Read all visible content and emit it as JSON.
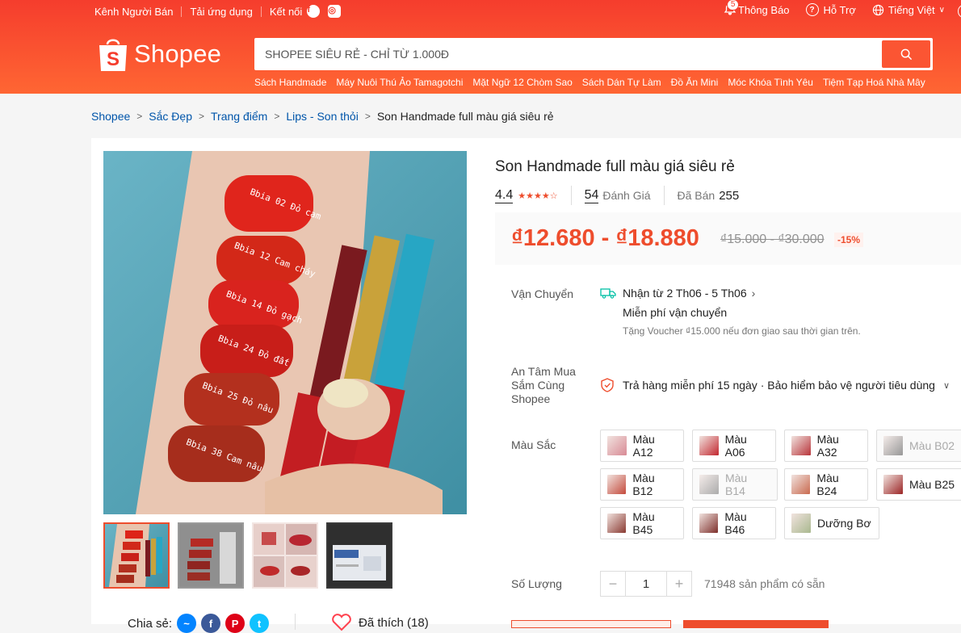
{
  "topbar": {
    "seller_center": "Kênh Người Bán",
    "download_app": "Tải ứng dụng",
    "connect": "Kết nối",
    "notifications": "Thông Báo",
    "notification_count": "5",
    "help": "Hỗ Trợ",
    "language": "Tiếng Việt"
  },
  "logo": {
    "text": "Shopee"
  },
  "search": {
    "placeholder": "SHOPEE SIÊU RẺ - CHỈ TỪ 1.000Đ",
    "suggestions": [
      "Sách Handmade",
      "Máy Nuôi Thú Ảo Tamagotchi",
      "Mặt Ngữ 12 Chòm Sao",
      "Sách Dán Tự Làm",
      "Đồ Ăn Mini",
      "Móc Khóa Tình Yêu",
      "Tiệm Tạp Hoá Nhà Mây"
    ]
  },
  "breadcrumb": {
    "items": [
      "Shopee",
      "Sắc Đẹp",
      "Trang điểm",
      "Lips - Son thỏi"
    ],
    "current": "Son Handmade full màu giá siêu rẻ"
  },
  "gallery": {
    "swatch_labels": [
      "Bbia 02 Đỏ cam",
      "Bbia 12 Cam cháy",
      "Bbia 14 Đỏ gạch",
      "Bbia 24 Đỏ đất",
      "Bbia 25 Đỏ nâu",
      "Bbia 38 Cam nâu"
    ]
  },
  "share": {
    "label": "Chia sẻ:"
  },
  "like": {
    "label": "Đã thích (18)"
  },
  "product": {
    "title": "Son Handmade full màu giá siêu rẻ",
    "rating": "4.4",
    "rating_stars": 4.4,
    "reviews_count": "54",
    "reviews_label": "Đánh Giá",
    "sold_label": "Đã Bán",
    "sold_count": "255",
    "price": "₫12.680 - ₫18.880",
    "original_price": "₫15.000 - ₫30.000",
    "discount": "-15%"
  },
  "shipping": {
    "label": "Vận Chuyển",
    "eta": "Nhận từ 2 Th06 - 5 Th06",
    "free": "Miễn phí vận chuyển",
    "voucher": "Tặng Voucher ₫15.000 nếu đơn giao sau thời gian trên."
  },
  "guarantee": {
    "label": "An Tâm Mua Sắm Cùng Shopee",
    "text": "Trả hàng miễn phí 15 ngày · Bảo hiểm bảo vệ người tiêu dùng"
  },
  "colors": {
    "label": "Màu Sắc",
    "options": [
      {
        "label": "Màu A12",
        "disabled": false,
        "swatch": "#d88a95"
      },
      {
        "label": "Màu A06",
        "disabled": false,
        "swatch": "#c2272f"
      },
      {
        "label": "Màu A32",
        "disabled": false,
        "swatch": "#b8343a"
      },
      {
        "label": "Màu B02",
        "disabled": true,
        "swatch": "#555555"
      },
      {
        "label": "Màu B12",
        "disabled": false,
        "swatch": "#c44a3c"
      },
      {
        "label": "Màu B14",
        "disabled": true,
        "swatch": "#777777"
      },
      {
        "label": "Màu B24",
        "disabled": false,
        "swatch": "#c96a4f"
      },
      {
        "label": "Màu B25",
        "disabled": false,
        "swatch": "#9b2525"
      },
      {
        "label": "Màu B45",
        "disabled": false,
        "swatch": "#8a3a32"
      },
      {
        "label": "Màu B46",
        "disabled": false,
        "swatch": "#7d2e2a"
      },
      {
        "label": "Dưỡng Bơ",
        "disabled": false,
        "swatch": "#a9b88f"
      }
    ]
  },
  "quantity": {
    "label": "Số Lượng",
    "value": "1",
    "available": "71948 sản phẩm có sẵn"
  },
  "theme": {
    "brand": "#ee4d2d",
    "link": "#0055aa"
  }
}
